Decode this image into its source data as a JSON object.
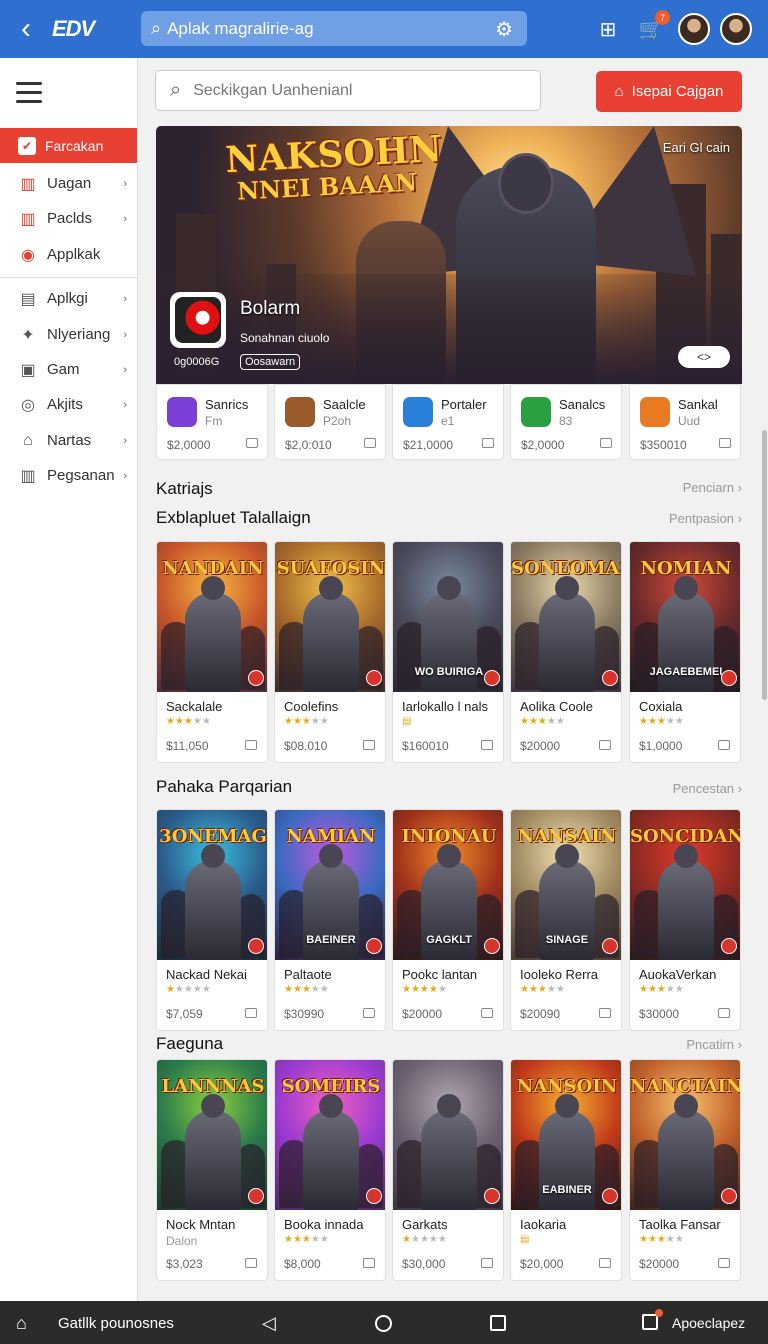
{
  "topbar": {
    "logo": "EDV",
    "search_text": "Aplak magralirie-ag",
    "notif_count": "7"
  },
  "sidebar": {
    "items": [
      {
        "label": "Farcakan",
        "icon": "check-icon"
      },
      {
        "label": "Uagan",
        "icon": "chart-icon"
      },
      {
        "label": "Paclds",
        "icon": "chart-icon"
      },
      {
        "label": "Applkak",
        "icon": "circle-icon"
      },
      {
        "label": "Aplkgi",
        "icon": "doc-icon"
      },
      {
        "label": "Nlyeriang",
        "icon": "gamepad-icon"
      },
      {
        "label": "Gam",
        "icon": "box-icon"
      },
      {
        "label": "Akjits",
        "icon": "target-icon"
      },
      {
        "label": "Nartas",
        "icon": "home-icon"
      },
      {
        "label": "Pegsanan",
        "icon": "chart-icon"
      }
    ]
  },
  "main": {
    "search_placeholder": "Seckikgan Uanhenianl",
    "red_button": "Isepai Cajgan",
    "hero": {
      "title_line1": "NAKSOHN",
      "title_line2": "NNEI BAAAN",
      "top_right": "Eari Gl cain",
      "app_name": "Bolarm",
      "app_sub": "Sonahnan ciuolo",
      "count": "0g0006G",
      "pill": "Oosawarn",
      "toggle": "<>"
    },
    "apps": [
      {
        "name": "Sanrics",
        "sub": "Fm",
        "price": "$2,0000",
        "color": "#7b3fd8"
      },
      {
        "name": "Saalcle",
        "sub": "P2oh",
        "price": "$2,0:010",
        "color": "#9a5a2a"
      },
      {
        "name": "Portaler",
        "sub": "e1",
        "price": "$21,0000",
        "color": "#2a7fd8"
      },
      {
        "name": "Sanalcs",
        "sub": "83",
        "price": "$2,0000",
        "color": "#2aa040"
      },
      {
        "name": "Sankal",
        "sub": "Uud",
        "price": "$350010",
        "color": "#e87a22"
      }
    ],
    "section1": {
      "title": "Katriajs",
      "more": "Penciarn"
    },
    "section2": {
      "title": "Exblapluet Talallaign",
      "more": "Pentpasion",
      "cards": [
        {
          "art_title": "NANDAIN",
          "name": "Sackalale",
          "price": "$11,050",
          "rating": 3,
          "sub": ""
        },
        {
          "art_title": "SUAFOSIN",
          "name": "Coolefins",
          "price": "$08.010",
          "rating": 3,
          "sub": ""
        },
        {
          "art_title": "",
          "name": "Iarlokallo l nals",
          "price": "$160010",
          "rating": 0,
          "sub": "WO BUIRIGA"
        },
        {
          "art_title": "SONEOMAS",
          "name": "Aolika Coole",
          "price": "$20000",
          "rating": 3,
          "sub": ""
        },
        {
          "art_title": "NOMIAN",
          "name": "Coxiala",
          "price": "$1,0000",
          "rating": 3,
          "sub": "JAGAEBEMEI"
        }
      ]
    },
    "section3": {
      "title": "Pahaka Parqarian",
      "more": "Pencestan",
      "cards": [
        {
          "art_title": "3ONEMAG",
          "name": "Nackad Nekai",
          "price": "$7,059",
          "rating": 1,
          "sub": ""
        },
        {
          "art_title": "NAMIAN",
          "name": "Paltaote",
          "price": "$30990",
          "rating": 3,
          "sub": "BAEINER"
        },
        {
          "art_title": "INIONAU",
          "name": "Pookc lantan",
          "price": "$20000",
          "rating": 4,
          "sub": "GAGKLT"
        },
        {
          "art_title": "NANSAIN",
          "name": "Iooleko Rerra",
          "price": "$20090",
          "rating": 3,
          "sub": "SINAGE"
        },
        {
          "art_title": "SONCIDAN",
          "name": "AuokaVerkan",
          "price": "$30000",
          "rating": 3,
          "sub": ""
        }
      ]
    },
    "section4": {
      "title": "Faeguna",
      "more": "Pncatirn",
      "cards": [
        {
          "art_title": "LANNNAS",
          "name": "Nock Mntan",
          "sub_text": "Dalon",
          "price": "$3,023",
          "rating": 0,
          "sub": ""
        },
        {
          "art_title": "SOMEIRS",
          "name": "Booka innada",
          "sub_text": "",
          "price": "$8,000",
          "rating": 3,
          "sub": ""
        },
        {
          "art_title": "",
          "name": "Garkats",
          "sub_text": "",
          "price": "$30,000",
          "rating": 1,
          "sub": ""
        },
        {
          "art_title": "NANSOIN",
          "name": "Iaokaria",
          "sub_text": "",
          "price": "$20,000",
          "rating": 0,
          "sub": "EABINER"
        },
        {
          "art_title": "NANCTAIN",
          "name": "Taolka Fansar",
          "sub_text": "",
          "price": "$20000",
          "rating": 3,
          "sub": ""
        }
      ]
    }
  },
  "bottombar": {
    "left_text": "Gatllk pounosnes",
    "right_text": "Apoeclapez"
  }
}
